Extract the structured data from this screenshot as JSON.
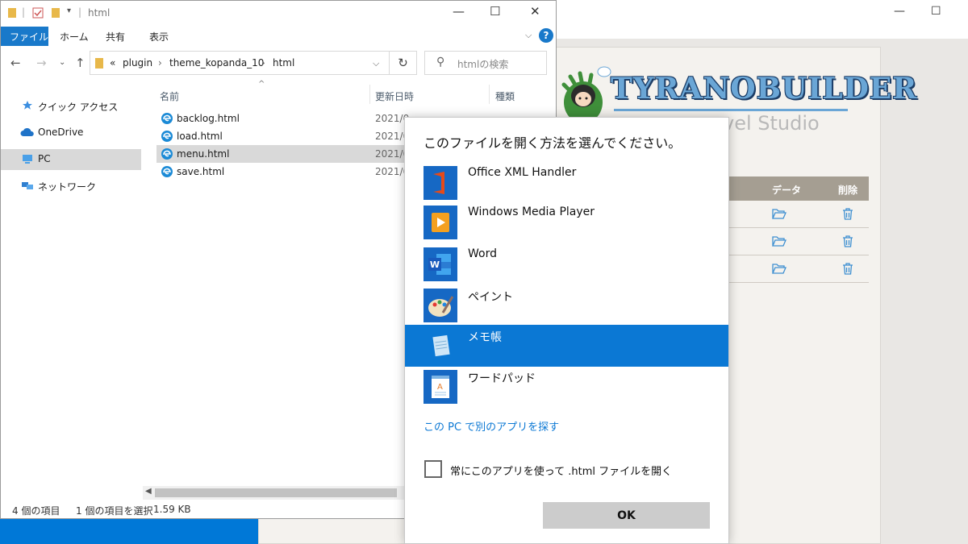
{
  "explorer": {
    "title": "html",
    "tabs": [
      "ファイル",
      "ホーム",
      "共有",
      "表示"
    ],
    "breadcrumb": [
      "«",
      "plugin",
      "theme_kopanda_10",
      "html"
    ],
    "search_placeholder": "htmlの検索",
    "sidebar": [
      "クイック アクセス",
      "OneDrive",
      "PC",
      "ネットワーク"
    ],
    "columns": [
      "名前",
      "更新日時",
      "種類"
    ],
    "files": [
      {
        "name": "backlog.html",
        "date": "2021/0"
      },
      {
        "name": "load.html",
        "date": "2021/0"
      },
      {
        "name": "menu.html",
        "date": "2021/0"
      },
      {
        "name": "save.html",
        "date": "2021/0"
      }
    ],
    "status": {
      "count": "4 個の項目",
      "selected": "1 個の項目を選択",
      "size": "1.59 KB"
    }
  },
  "tyrano": {
    "logo": "TYRANOBUILDER",
    "subtitle": "vel Studio",
    "columns": [
      "データ",
      "削除"
    ]
  },
  "dialog": {
    "title": "このファイルを開く方法を選んでください。",
    "apps": [
      {
        "name": "Office XML Handler",
        "icon": "office-icon"
      },
      {
        "name": "Windows Media Player",
        "icon": "media-player-icon"
      },
      {
        "name": "Word",
        "icon": "word-icon"
      },
      {
        "name": "ペイント",
        "icon": "paint-icon"
      },
      {
        "name": "メモ帳",
        "icon": "notepad-icon"
      },
      {
        "name": "ワードパッド",
        "icon": "wordpad-icon"
      }
    ],
    "selected_index": 4,
    "more_apps_link": "この PC で別のアプリを探す",
    "always_use": "常にこのアプリを使って .html ファイルを開く",
    "ok_label": "OK"
  },
  "colors": {
    "accent": "#0b78d4",
    "desktop": "#0078d7",
    "ribbon_file": "#1979ca"
  }
}
